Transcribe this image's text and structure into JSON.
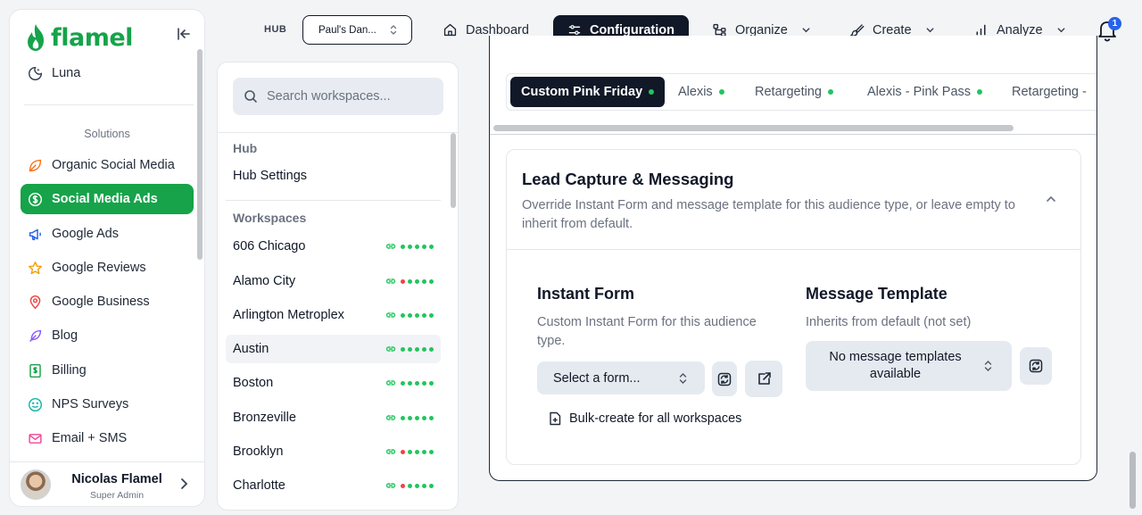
{
  "brand": {
    "name": "flamel",
    "color": "#16a34a"
  },
  "sidebar": {
    "top_item": {
      "label": "Luna",
      "icon": "moon-icon"
    },
    "section_label": "Solutions",
    "items": [
      {
        "label": "Organic Social Media",
        "icon": "leaf-icon",
        "color": "#f97316",
        "active": false
      },
      {
        "label": "Social Media Ads",
        "icon": "dollar-circle-icon",
        "color": "#ffffff",
        "active": true
      },
      {
        "label": "Google Ads",
        "icon": "megaphone-icon",
        "color": "#2563eb",
        "active": false
      },
      {
        "label": "Google Reviews",
        "icon": "star-icon",
        "color": "#f59e0b",
        "active": false
      },
      {
        "label": "Google Business",
        "icon": "map-pin-icon",
        "color": "#ef4444",
        "active": false
      },
      {
        "label": "Blog",
        "icon": "feather-icon",
        "color": "#8b5cf6",
        "active": false
      },
      {
        "label": "Billing",
        "icon": "billing-icon",
        "color": "#16a34a",
        "active": false
      },
      {
        "label": "NPS Surveys",
        "icon": "smiley-icon",
        "color": "#14b8a6",
        "active": false
      },
      {
        "label": "Email + SMS",
        "icon": "mail-icon",
        "color": "#ec4899",
        "active": false
      }
    ],
    "user": {
      "name": "Nicolas Flamel",
      "role": "Super Admin"
    }
  },
  "topnav": {
    "hub_label": "HUB",
    "hub_value": "Paul's Dan...",
    "items": [
      {
        "label": "Dashboard",
        "icon": "home-icon",
        "active": false,
        "dropdown": false
      },
      {
        "label": "Configuration",
        "icon": "sliders-icon",
        "active": true,
        "dropdown": false
      },
      {
        "label": "Organize",
        "icon": "organize-icon",
        "active": false,
        "dropdown": true
      },
      {
        "label": "Create",
        "icon": "brush-icon",
        "active": false,
        "dropdown": true
      },
      {
        "label": "Analyze",
        "icon": "bar-chart-icon",
        "active": false,
        "dropdown": true
      }
    ],
    "notifications_count": "1"
  },
  "workspaces": {
    "search_placeholder": "Search workspaces...",
    "hub_heading": "Hub",
    "hub_settings_label": "Hub Settings",
    "workspaces_heading": "Workspaces",
    "status_colors": {
      "ok": "#22c55e",
      "error": "#ef4444"
    },
    "items": [
      {
        "name": "606 Chicago",
        "statuses": [
          "ok",
          "ok",
          "ok",
          "ok",
          "ok"
        ]
      },
      {
        "name": "Alamo City",
        "statuses": [
          "error",
          "ok",
          "ok",
          "ok",
          "ok"
        ]
      },
      {
        "name": "Arlington Metroplex",
        "statuses": [
          "ok",
          "ok",
          "ok",
          "ok",
          "ok"
        ]
      },
      {
        "name": "Austin",
        "statuses": [
          "ok",
          "ok",
          "ok",
          "ok",
          "ok"
        ]
      },
      {
        "name": "Boston",
        "statuses": [
          "ok",
          "ok",
          "ok",
          "ok",
          "ok"
        ]
      },
      {
        "name": "Bronzeville",
        "statuses": [
          "ok",
          "ok",
          "ok",
          "ok",
          "ok"
        ]
      },
      {
        "name": "Brooklyn",
        "statuses": [
          "error",
          "ok",
          "ok",
          "ok",
          "ok"
        ]
      },
      {
        "name": "Charlotte",
        "statuses": [
          "error",
          "ok",
          "ok",
          "ok",
          "ok"
        ]
      }
    ]
  },
  "audience_tabs": [
    {
      "label": "Custom Pink Friday",
      "active": true
    },
    {
      "label": "Alexis",
      "active": false
    },
    {
      "label": "Retargeting",
      "active": false
    },
    {
      "label": "Alexis - Pink Pass",
      "active": false
    },
    {
      "label": "Retargeting - ",
      "active": false
    }
  ],
  "lead_capture": {
    "title": "Lead Capture & Messaging",
    "description": "Override Instant Form and message template for this audience type, or leave empty to inherit from default.",
    "instant_form": {
      "title": "Instant Form",
      "description": "Custom Instant Form for this audience type.",
      "select_label": "Select a form..."
    },
    "message_template": {
      "title": "Message Template",
      "description": "Inherits from default (not set)",
      "select_label": "No message templates available"
    },
    "bulk_label": "Bulk-create for all workspaces"
  }
}
